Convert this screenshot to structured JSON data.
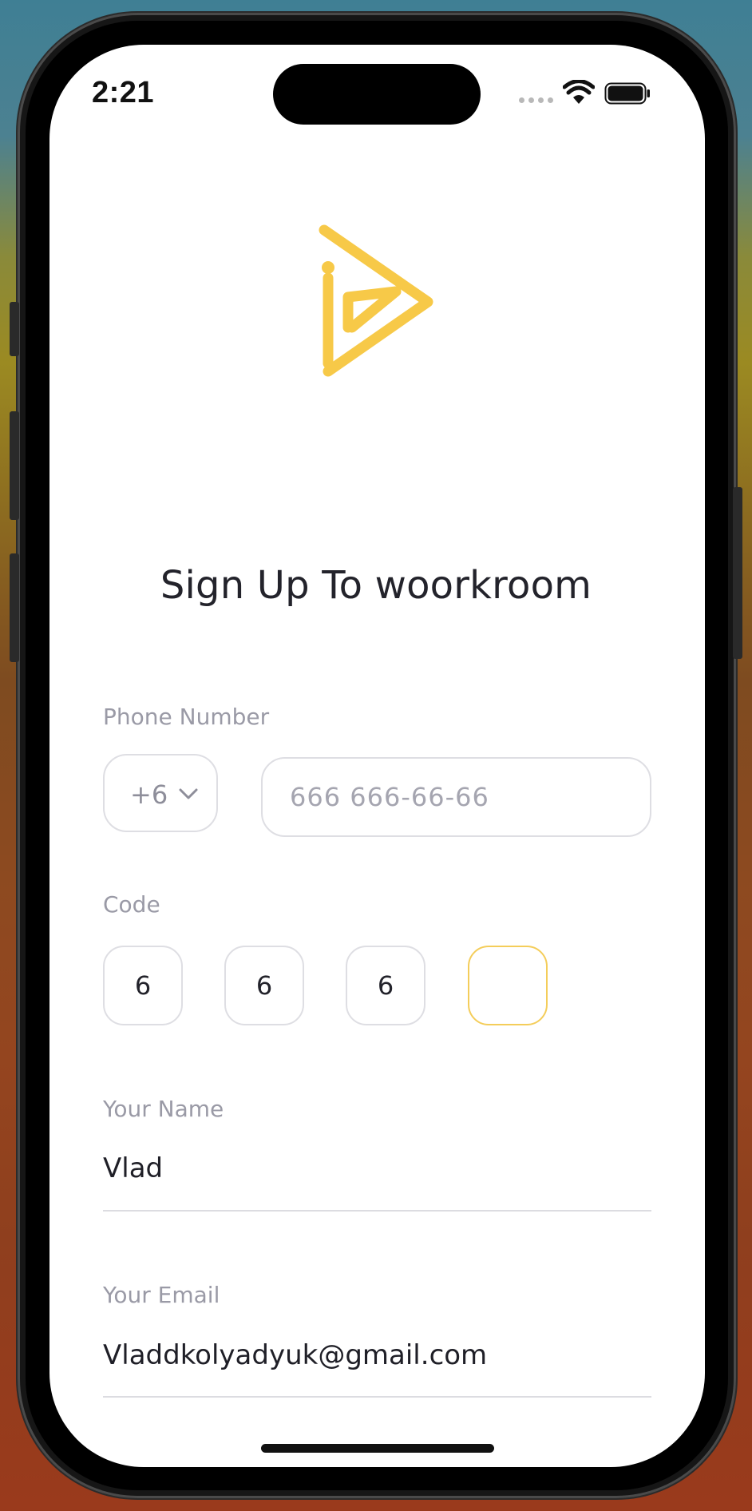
{
  "status_bar": {
    "time": "2:21"
  },
  "app": {
    "logo_icon": "woorkroom-logo-icon",
    "brand_color": "#F7C948",
    "title": "Sign Up To woorkroom"
  },
  "form": {
    "phone": {
      "label": "Phone Number",
      "country_code": "+6",
      "placeholder": "666 666-66-66",
      "value": ""
    },
    "code": {
      "label": "Code",
      "digits": [
        "6",
        "6",
        "6",
        ""
      ]
    },
    "name": {
      "label": "Your Name",
      "value": "Vlad"
    },
    "email": {
      "label": "Your Email",
      "value": "Vladdkolyadyuk@gmail.com"
    }
  },
  "colors": {
    "label": "#9A9AA6",
    "border": "#DEDEE3",
    "active_border": "#F4CD5A",
    "text": "#23232B"
  }
}
